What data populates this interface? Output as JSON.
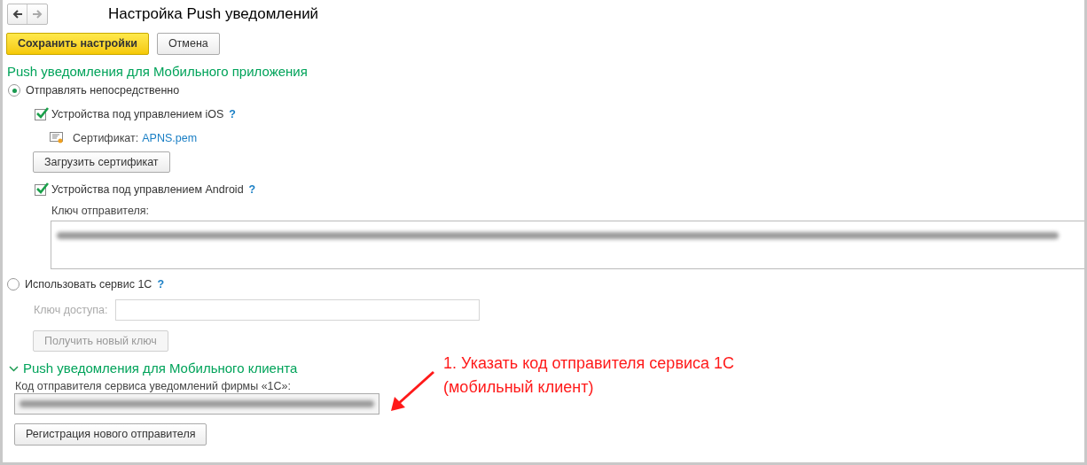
{
  "window": {
    "title": "Настройка Push уведомлений"
  },
  "toolbar": {
    "buttons": [
      {
        "label": "Сохранить настройки",
        "kind": "primary"
      },
      {
        "label": "Отмена",
        "kind": "normal"
      }
    ]
  },
  "mobile_app": {
    "title": "Push уведомления для Мобильного приложения",
    "send_directly": {
      "label": "Отправлять непосредственно",
      "selected": true
    },
    "ios": {
      "label": "Устройства под управлением iOS",
      "help": "?",
      "checked": true
    },
    "certificate": {
      "label": "Сертификат:",
      "link": "APNS.pem"
    },
    "upload_button": "Загрузить сертификат",
    "android": {
      "label": "Устройства под управлением Android",
      "help": "?",
      "checked": true
    },
    "sender_key": {
      "label": "Ключ отправителя:"
    },
    "use_1c": {
      "label": "Использовать сервис 1С",
      "help": "?",
      "selected": false
    },
    "access_key": {
      "label": "Ключ доступа:",
      "disabled": true
    },
    "new_key_button": {
      "label": "Получить новый ключ",
      "disabled": true
    }
  },
  "mobile_client": {
    "title": "Push уведомления для Мобильного клиента",
    "expanded": true,
    "code": {
      "label": "Код отправителя сервиса уведомлений фирмы «1С»:"
    },
    "register_button": "Регистрация нового отправителя"
  },
  "annotation": {
    "lines": [
      "1. Указать код отправителя сервиса 1С",
      "(мобильный клиент)"
    ]
  }
}
